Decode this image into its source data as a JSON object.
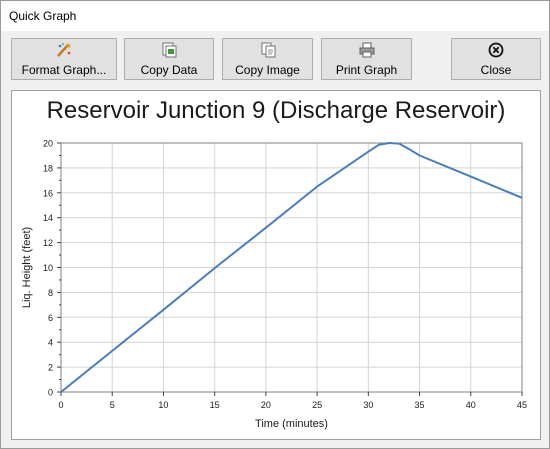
{
  "window": {
    "title": "Quick Graph"
  },
  "toolbar": {
    "format_graph": "Format Graph...",
    "copy_data": "Copy Data",
    "copy_image": "Copy Image",
    "print_graph": "Print Graph",
    "close": "Close"
  },
  "icons": {
    "format_graph": "format-graph-icon",
    "copy_data": "copy-data-icon",
    "copy_image": "copy-image-icon",
    "print_graph": "printer-icon",
    "close": "close-icon"
  },
  "colors": {
    "series": "#4a7ebb",
    "grid": "#d3d3d3"
  },
  "chart_data": {
    "type": "line",
    "title": "Reservoir Junction 9 (Discharge Reservoir)",
    "xlabel": "Time (minutes)",
    "ylabel": "Liq. Height (feet)",
    "xlim": [
      0,
      45
    ],
    "ylim": [
      0,
      20
    ],
    "xticks": [
      0,
      5,
      10,
      15,
      20,
      25,
      30,
      35,
      40,
      45
    ],
    "yticks": [
      0,
      2,
      4,
      6,
      8,
      10,
      12,
      14,
      16,
      18,
      20
    ],
    "grid": true,
    "series": [
      {
        "x": [
          0,
          5,
          10,
          15,
          20,
          25,
          30,
          31,
          32,
          33,
          34,
          35,
          40,
          45
        ],
        "y": [
          0,
          3.3,
          6.6,
          9.95,
          13.2,
          16.5,
          19.3,
          19.85,
          20.0,
          19.95,
          19.5,
          19.0,
          17.3,
          15.6
        ]
      }
    ]
  }
}
